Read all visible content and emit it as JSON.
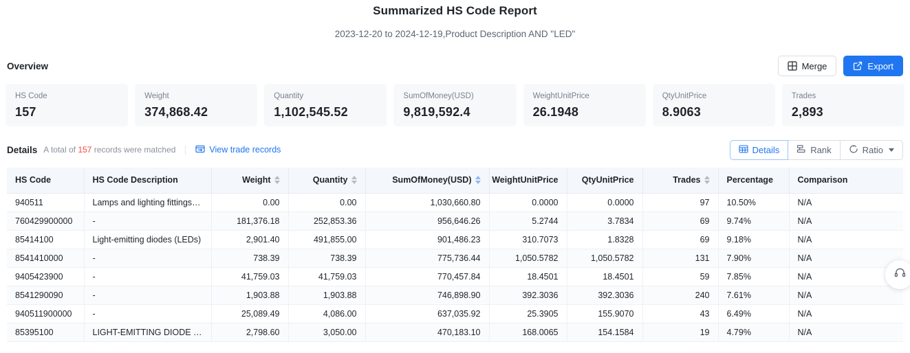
{
  "header": {
    "title": "Summarized HS Code Report",
    "subtitle": "2023-12-20 to 2024-12-19,Product Description AND \"LED\""
  },
  "overview": {
    "label": "Overview",
    "merge_label": "Merge",
    "export_label": "Export",
    "merge_icon": "grid-icon",
    "export_icon": "external-link-icon",
    "accent_color": "#1f76f0",
    "cards": [
      {
        "label": "HS Code",
        "value": "157"
      },
      {
        "label": "Weight",
        "value": "374,868.42"
      },
      {
        "label": "Quantity",
        "value": "1,102,545.52"
      },
      {
        "label": "SumOfMoney(USD)",
        "value": "9,819,592.4"
      },
      {
        "label": "WeightUnitPrice",
        "value": "26.1948"
      },
      {
        "label": "QtyUnitPrice",
        "value": "8.9063"
      },
      {
        "label": "Trades",
        "value": "2,893"
      }
    ]
  },
  "details": {
    "title": "Details",
    "meta_prefix": "A total of",
    "count": "157",
    "meta_suffix": "records were matched",
    "view_records_label": "View trade records",
    "view_records_icon": "records-icon",
    "count_color": "#f5483b",
    "segments": [
      {
        "label": "Details",
        "icon": "table-icon",
        "active": true,
        "has_caret": false
      },
      {
        "label": "Rank",
        "icon": "rank-icon",
        "active": false,
        "has_caret": false
      },
      {
        "label": "Ratio",
        "icon": "circle-icon",
        "active": false,
        "has_caret": true
      }
    ]
  },
  "table": {
    "columns": [
      {
        "label": "HS Code",
        "align": "left",
        "sortable": false,
        "sort_active": false
      },
      {
        "label": "HS Code Description",
        "align": "left",
        "sortable": false,
        "sort_active": false
      },
      {
        "label": "Weight",
        "align": "right",
        "sortable": true,
        "sort_active": false
      },
      {
        "label": "Quantity",
        "align": "right",
        "sortable": true,
        "sort_active": false
      },
      {
        "label": "SumOfMoney(USD)",
        "align": "right",
        "sortable": true,
        "sort_active": true
      },
      {
        "label": "WeightUnitPrice",
        "align": "right",
        "sortable": false,
        "sort_active": false
      },
      {
        "label": "QtyUnitPrice",
        "align": "right",
        "sortable": false,
        "sort_active": false
      },
      {
        "label": "Trades",
        "align": "right",
        "sortable": true,
        "sort_active": false
      },
      {
        "label": "Percentage",
        "align": "left",
        "sortable": false,
        "sort_active": false
      },
      {
        "label": "Comparison",
        "align": "left",
        "sortable": false,
        "sort_active": false
      }
    ],
    "rows": [
      {
        "hs_code": "940511",
        "description": "Lamps and lighting fittings, n.e.s; ...",
        "weight": "0.00",
        "quantity": "0.00",
        "sum_of_money": "1,030,660.80",
        "weight_unit_price": "0.0000",
        "qty_unit_price": "0.0000",
        "trades": "97",
        "percentage": "10.50%",
        "comparison": "N/A"
      },
      {
        "hs_code": "760429900000",
        "description": "-",
        "weight": "181,376.18",
        "quantity": "252,853.36",
        "sum_of_money": "956,646.26",
        "weight_unit_price": "5.2744",
        "qty_unit_price": "3.7834",
        "trades": "69",
        "percentage": "9.74%",
        "comparison": "N/A"
      },
      {
        "hs_code": "85414100",
        "description": "Light-emitting diodes (LEDs)",
        "weight": "2,901.40",
        "quantity": "491,855.00",
        "sum_of_money": "901,486.23",
        "weight_unit_price": "310.7073",
        "qty_unit_price": "1.8328",
        "trades": "69",
        "percentage": "9.18%",
        "comparison": "N/A"
      },
      {
        "hs_code": "8541410000",
        "description": "-",
        "weight": "738.39",
        "quantity": "738.39",
        "sum_of_money": "775,736.44",
        "weight_unit_price": "1,050.5782",
        "qty_unit_price": "1,050.5782",
        "trades": "131",
        "percentage": "7.90%",
        "comparison": "N/A"
      },
      {
        "hs_code": "9405423900",
        "description": "-",
        "weight": "41,759.03",
        "quantity": "41,759.03",
        "sum_of_money": "770,457.84",
        "weight_unit_price": "18.4501",
        "qty_unit_price": "18.4501",
        "trades": "59",
        "percentage": "7.85%",
        "comparison": "N/A"
      },
      {
        "hs_code": "8541290090",
        "description": "-",
        "weight": "1,903.88",
        "quantity": "1,903.88",
        "sum_of_money": "746,898.90",
        "weight_unit_price": "392.3036",
        "qty_unit_price": "392.3036",
        "trades": "240",
        "percentage": "7.61%",
        "comparison": "N/A"
      },
      {
        "hs_code": "940511900000",
        "description": "-",
        "weight": "25,089.49",
        "quantity": "4,086.00",
        "sum_of_money": "637,035.92",
        "weight_unit_price": "25.3905",
        "qty_unit_price": "155.9070",
        "trades": "43",
        "percentage": "6.49%",
        "comparison": "N/A"
      },
      {
        "hs_code": "85395100",
        "description": "LIGHT-EMITTING DIODE (LED) LI...",
        "weight": "2,798.60",
        "quantity": "3,050.00",
        "sum_of_money": "470,183.10",
        "weight_unit_price": "168.0065",
        "qty_unit_price": "154.1584",
        "trades": "19",
        "percentage": "4.79%",
        "comparison": "N/A"
      }
    ]
  },
  "support": {
    "icon": "headset-icon"
  }
}
